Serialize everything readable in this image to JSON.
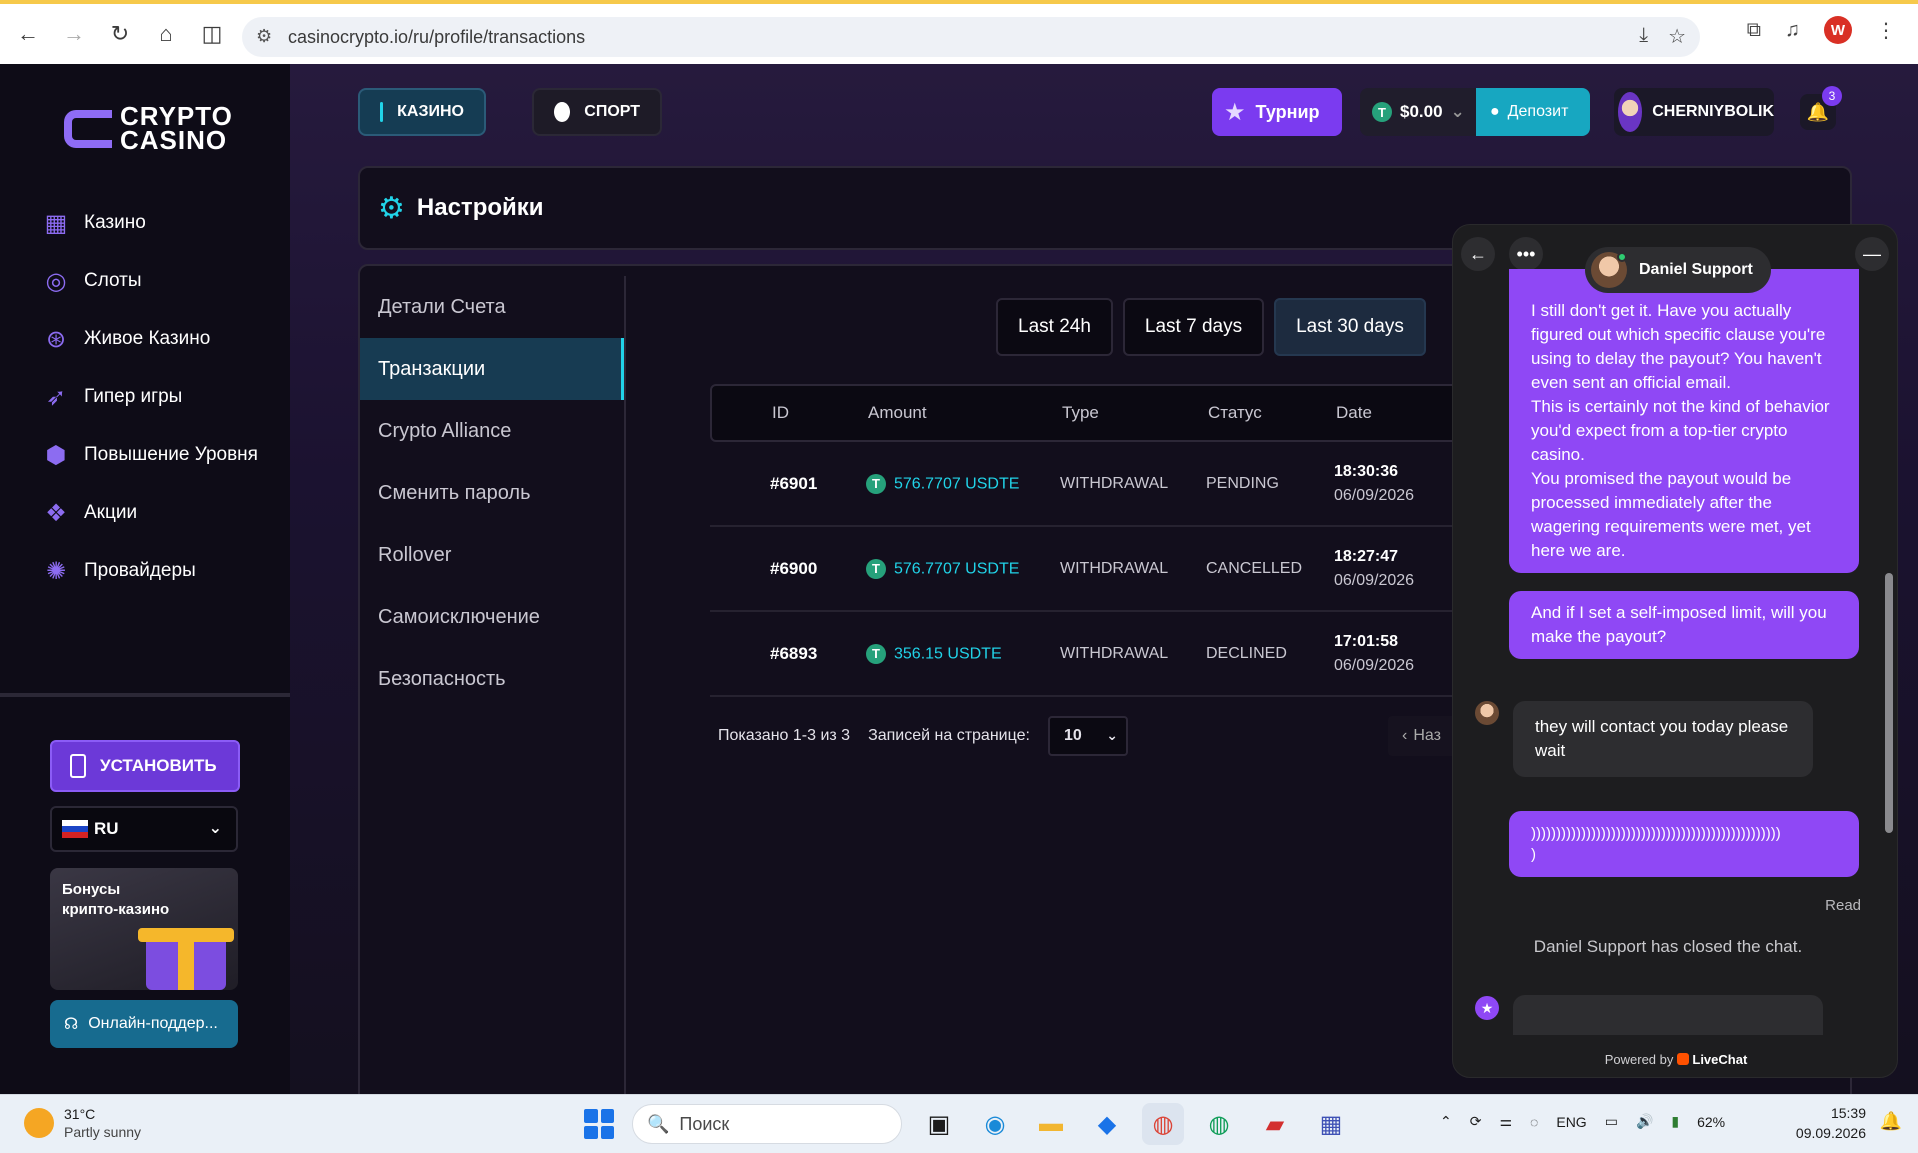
{
  "browser": {
    "url": "casinocrypto.io/ru/profile/transactions",
    "profile_initial": "W"
  },
  "sidebar": {
    "logo_line1": "CRYPTO",
    "logo_line2": "CASINO",
    "items": [
      {
        "label": "Казино",
        "icon": "grid-icon"
      },
      {
        "label": "Слоты",
        "icon": "swirl-icon"
      },
      {
        "label": "Живое Казино",
        "icon": "chip-icon"
      },
      {
        "label": "Гипер игры",
        "icon": "rocket-icon"
      },
      {
        "label": "Повышение Уровня",
        "icon": "level-up-icon"
      },
      {
        "label": "Акции",
        "icon": "gift-icon"
      },
      {
        "label": "Провайдеры",
        "icon": "provider-icon"
      }
    ],
    "install_label": "УСТАНОВИТЬ",
    "language": "RU",
    "bonus_title_line1": "Бонусы",
    "bonus_title_line2": "крипто-казино",
    "support_label": "Онлайн-поддер..."
  },
  "header": {
    "tab_casino": "КАЗИНО",
    "tab_sport": "СПОРТ",
    "tournament": "Турнир",
    "balance": "$0.00",
    "deposit": "Депозит",
    "username": "CHERNIYBOLIK",
    "notifications": "3"
  },
  "settings": {
    "title": "Настройки",
    "menu": [
      {
        "label": "Детали Счета",
        "active": false
      },
      {
        "label": "Транзакции",
        "active": true
      },
      {
        "label": "Crypto Alliance",
        "active": false
      },
      {
        "label": "Сменить пароль",
        "active": false
      },
      {
        "label": "Rollover",
        "active": false
      },
      {
        "label": "Самоисключение",
        "active": false
      },
      {
        "label": "Безопасность",
        "active": false
      }
    ]
  },
  "filters": [
    "Last 24h",
    "Last 7 days",
    "Last 30 days"
  ],
  "table": {
    "headers": [
      "ID",
      "Amount",
      "Type",
      "Статус",
      "Date"
    ],
    "rows": [
      {
        "id": "#6901",
        "amount": "576.7707 USDTE",
        "type": "WITHDRAWAL",
        "status": "PENDING",
        "time": "18:30:36",
        "date": "06/09/2026"
      },
      {
        "id": "#6900",
        "amount": "576.7707 USDTE",
        "type": "WITHDRAWAL",
        "status": "CANCELLED",
        "time": "18:27:47",
        "date": "06/09/2026"
      },
      {
        "id": "#6893",
        "amount": "356.15 USDTE",
        "type": "WITHDRAWAL",
        "status": "DECLINED",
        "time": "17:01:58",
        "date": "06/09/2026"
      }
    ],
    "shown": "Показано 1-3 из 3",
    "per_page_label": "Записей на странице:",
    "per_page_value": "10",
    "prev_label": "Наз"
  },
  "chat": {
    "agent_name": "Daniel Support",
    "msg1": "I still don't get it. Have you actually figured out which specific clause you're using to delay the payout? You haven't even sent an official email.\nThis is certainly not the kind of behavior you'd expect from a top-tier crypto casino.\nYou promised the payout would be processed immediately after the wagering requirements were met, yet here we are.",
    "msg2": "And if I set a self-imposed limit, will you make the payout?",
    "agent_msg": "they will contact you today please wait",
    "msg3": "))))))))))))))))))))))))))))))))))))))))))))))))))\n)",
    "read": "Read",
    "closed": "Daniel Support has closed the chat.",
    "powered_prefix": "Powered by",
    "powered_brand": "LiveChat"
  },
  "taskbar": {
    "temp": "31°C",
    "weather": "Partly sunny",
    "search": "Поиск",
    "lang": "ENG",
    "battery": "62%",
    "time": "15:39",
    "date": "09.09.2026"
  }
}
